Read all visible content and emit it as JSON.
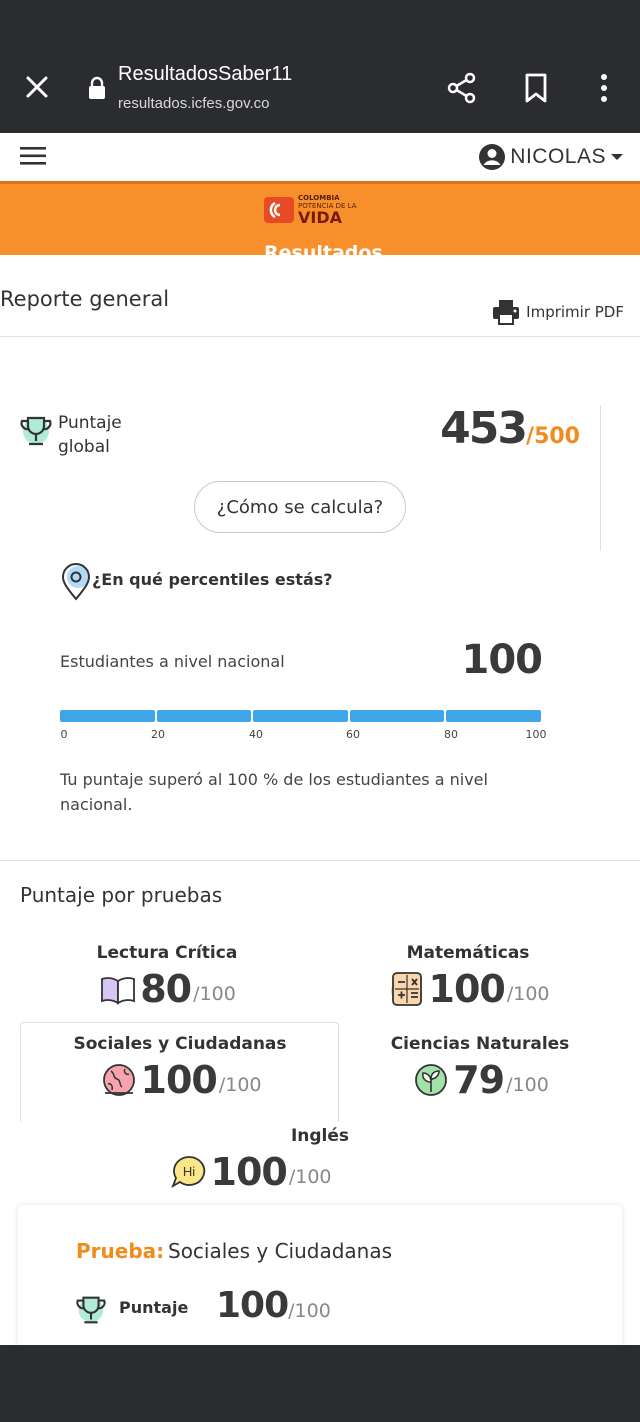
{
  "browser": {
    "title": "ResultadosSaber11",
    "url": "resultados.icfes.gov.co"
  },
  "topbar": {
    "user_name": "NICOLAS"
  },
  "banner": {
    "logo_line1": "COLOMBIA",
    "logo_line2": "POTENCIA DE LA",
    "logo_line3": "VIDA",
    "heading": "Resultados"
  },
  "report": {
    "title": "Reporte general",
    "print_label": "Imprimir PDF"
  },
  "global_score": {
    "label": "Puntaje global",
    "value": "453",
    "max": "/500",
    "how_button": "¿Cómo se calcula?"
  },
  "percentile": {
    "question": "¿En qué percentiles estás?",
    "national_label": "Estudiantes a nivel nacional",
    "national_value": "100",
    "bar_fraction": 1.0,
    "ticks": [
      "0",
      "20",
      "40",
      "60",
      "80",
      "100"
    ],
    "summary": "Tu puntaje superó al 100 % de los estudiantes a nivel nacional."
  },
  "tests": {
    "title": "Puntaje por pruebas",
    "items": [
      {
        "name": "Lectura Crítica",
        "value": "80",
        "max": "/100",
        "icon": "book-icon"
      },
      {
        "name": "Matemáticas",
        "value": "100",
        "max": "/100",
        "icon": "calculator-icon"
      },
      {
        "name": "Sociales y Ciudadanas",
        "value": "100",
        "max": "/100",
        "icon": "globe-icon"
      },
      {
        "name": "Ciencias Naturales",
        "value": "79",
        "max": "/100",
        "icon": "plant-icon"
      },
      {
        "name": "Inglés",
        "value": "100",
        "max": "/100",
        "icon": "speech-bubble-icon"
      }
    ]
  },
  "detail": {
    "prueba_label": "Prueba:",
    "prueba_name": "Sociales y Ciudadanas",
    "puntaje_label": "Puntaje",
    "value": "100",
    "max": "/100"
  },
  "colors": {
    "accent_orange": "#f7902b",
    "bar_blue": "#3ea6e8",
    "chrome_dark": "#2b2c2f"
  }
}
